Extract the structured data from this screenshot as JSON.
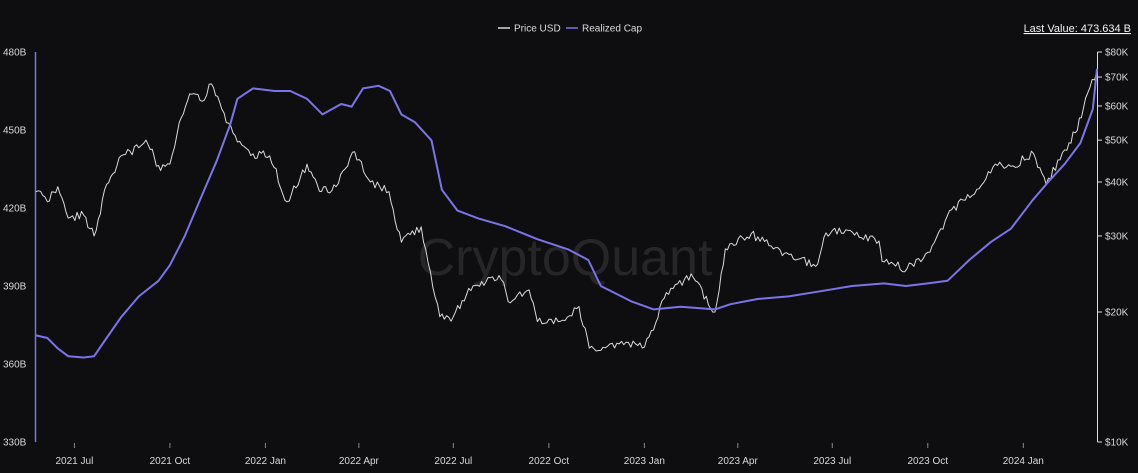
{
  "chart_data": {
    "type": "line",
    "legend": {
      "placement": "top-center",
      "items": [
        {
          "name": "Price USD",
          "color": "#d9d9d9"
        },
        {
          "name": "Realized Cap",
          "color": "#7b74e8"
        }
      ]
    },
    "last_value_text": "Last Value: 473.634 B",
    "watermark": "CryptoQuant",
    "grid": false,
    "x_ticks": [
      "2021 Jul",
      "2021 Oct",
      "2022 Jan",
      "2022 Apr",
      "2022 Jul",
      "2022 Oct",
      "2023 Jan",
      "2023 Apr",
      "2023 Jul",
      "2023 Oct",
      "2024 Jan"
    ],
    "x_range": [
      "2021-05-25",
      "2024-03-12"
    ],
    "left_axis": {
      "ticks": [
        "480B",
        "450B",
        "420B",
        "390B",
        "360B",
        "330B"
      ],
      "range": [
        330,
        480
      ],
      "unit": "B"
    },
    "right_axis": {
      "scale": "log",
      "ticks": [
        "$80K",
        "$70K",
        "$60K",
        "$50K",
        "$40K",
        "$30K",
        "$20K",
        "$10K"
      ],
      "range": [
        10000,
        80000
      ]
    },
    "series": [
      {
        "name": "Realized Cap",
        "axis": "left",
        "color": "#7b74e8",
        "points": [
          [
            "2021-05-25",
            371
          ],
          [
            "2021-06-05",
            370
          ],
          [
            "2021-06-15",
            366
          ],
          [
            "2021-06-25",
            363
          ],
          [
            "2021-07-10",
            362.5
          ],
          [
            "2021-07-20",
            363
          ],
          [
            "2021-08-01",
            370
          ],
          [
            "2021-08-15",
            378
          ],
          [
            "2021-09-01",
            386
          ],
          [
            "2021-09-20",
            392
          ],
          [
            "2021-10-01",
            398
          ],
          [
            "2021-10-15",
            409
          ],
          [
            "2021-11-01",
            425
          ],
          [
            "2021-11-15",
            438
          ],
          [
            "2021-11-28",
            452
          ],
          [
            "2021-12-05",
            462
          ],
          [
            "2021-12-20",
            466
          ],
          [
            "2022-01-10",
            465
          ],
          [
            "2022-01-25",
            465
          ],
          [
            "2022-02-10",
            462
          ],
          [
            "2022-02-25",
            456
          ],
          [
            "2022-03-15",
            460
          ],
          [
            "2022-03-25",
            459
          ],
          [
            "2022-04-05",
            466
          ],
          [
            "2022-04-20",
            467
          ],
          [
            "2022-05-01",
            465
          ],
          [
            "2022-05-12",
            456
          ],
          [
            "2022-05-25",
            453
          ],
          [
            "2022-06-10",
            446
          ],
          [
            "2022-06-20",
            427
          ],
          [
            "2022-07-05",
            419
          ],
          [
            "2022-07-25",
            416
          ],
          [
            "2022-08-20",
            413
          ],
          [
            "2022-09-20",
            408
          ],
          [
            "2022-10-20",
            404
          ],
          [
            "2022-11-08",
            400
          ],
          [
            "2022-11-20",
            390
          ],
          [
            "2022-12-20",
            384
          ],
          [
            "2023-01-10",
            381
          ],
          [
            "2023-02-05",
            382
          ],
          [
            "2023-03-10",
            381
          ],
          [
            "2023-03-25",
            383
          ],
          [
            "2023-04-20",
            385
          ],
          [
            "2023-05-20",
            386
          ],
          [
            "2023-06-20",
            388
          ],
          [
            "2023-07-20",
            390
          ],
          [
            "2023-08-20",
            391
          ],
          [
            "2023-09-10",
            390
          ],
          [
            "2023-10-01",
            391
          ],
          [
            "2023-10-20",
            392
          ],
          [
            "2023-11-10",
            400
          ],
          [
            "2023-12-01",
            407
          ],
          [
            "2023-12-20",
            412
          ],
          [
            "2024-01-10",
            423
          ],
          [
            "2024-01-25",
            430
          ],
          [
            "2024-02-10",
            437
          ],
          [
            "2024-02-25",
            445
          ],
          [
            "2024-03-08",
            458
          ],
          [
            "2024-03-12",
            473.634
          ]
        ]
      },
      {
        "name": "Price USD",
        "axis": "right",
        "color": "#d9d9d9",
        "points": [
          [
            "2021-05-25",
            38000
          ],
          [
            "2021-06-05",
            36000
          ],
          [
            "2021-06-15",
            39000
          ],
          [
            "2021-06-25",
            33000
          ],
          [
            "2021-07-10",
            33500
          ],
          [
            "2021-07-20",
            30000
          ],
          [
            "2021-08-01",
            39500
          ],
          [
            "2021-08-15",
            46000
          ],
          [
            "2021-09-01",
            48000
          ],
          [
            "2021-09-08",
            50000
          ],
          [
            "2021-09-22",
            42500
          ],
          [
            "2021-10-01",
            44000
          ],
          [
            "2021-10-10",
            55000
          ],
          [
            "2021-10-20",
            64000
          ],
          [
            "2021-11-01",
            61500
          ],
          [
            "2021-11-10",
            67500
          ],
          [
            "2021-11-20",
            59000
          ],
          [
            "2021-12-05",
            49500
          ],
          [
            "2021-12-20",
            46500
          ],
          [
            "2022-01-05",
            46000
          ],
          [
            "2022-01-22",
            36000
          ],
          [
            "2022-02-10",
            44000
          ],
          [
            "2022-02-24",
            38000
          ],
          [
            "2022-03-10",
            39000
          ],
          [
            "2022-03-28",
            47000
          ],
          [
            "2022-04-12",
            40000
          ],
          [
            "2022-04-30",
            38000
          ],
          [
            "2022-05-12",
            29000
          ],
          [
            "2022-05-31",
            31500
          ],
          [
            "2022-06-18",
            19500
          ],
          [
            "2022-07-01",
            19500
          ],
          [
            "2022-07-20",
            23000
          ],
          [
            "2022-08-14",
            24300
          ],
          [
            "2022-08-25",
            21000
          ],
          [
            "2022-09-12",
            22500
          ],
          [
            "2022-09-20",
            19000
          ],
          [
            "2022-10-10",
            19000
          ],
          [
            "2022-10-30",
            20600
          ],
          [
            "2022-11-09",
            16500
          ],
          [
            "2022-11-20",
            16300
          ],
          [
            "2022-12-10",
            17100
          ],
          [
            "2022-12-30",
            16500
          ],
          [
            "2023-01-12",
            18900
          ],
          [
            "2023-01-20",
            21500
          ],
          [
            "2023-02-15",
            24500
          ],
          [
            "2023-03-10",
            20000
          ],
          [
            "2023-03-20",
            28000
          ],
          [
            "2023-04-14",
            30400
          ],
          [
            "2023-05-01",
            28500
          ],
          [
            "2023-06-15",
            25500
          ],
          [
            "2023-06-25",
            30500
          ],
          [
            "2023-07-14",
            31000
          ],
          [
            "2023-08-15",
            29200
          ],
          [
            "2023-08-18",
            26200
          ],
          [
            "2023-09-11",
            25200
          ],
          [
            "2023-10-01",
            27500
          ],
          [
            "2023-10-24",
            34500
          ],
          [
            "2023-11-15",
            37500
          ],
          [
            "2023-12-05",
            44000
          ],
          [
            "2023-12-20",
            43500
          ],
          [
            "2024-01-11",
            46500
          ],
          [
            "2024-01-23",
            39500
          ],
          [
            "2024-02-10",
            47500
          ],
          [
            "2024-02-20",
            52000
          ],
          [
            "2024-03-05",
            66000
          ],
          [
            "2024-03-12",
            72000
          ]
        ]
      }
    ]
  }
}
